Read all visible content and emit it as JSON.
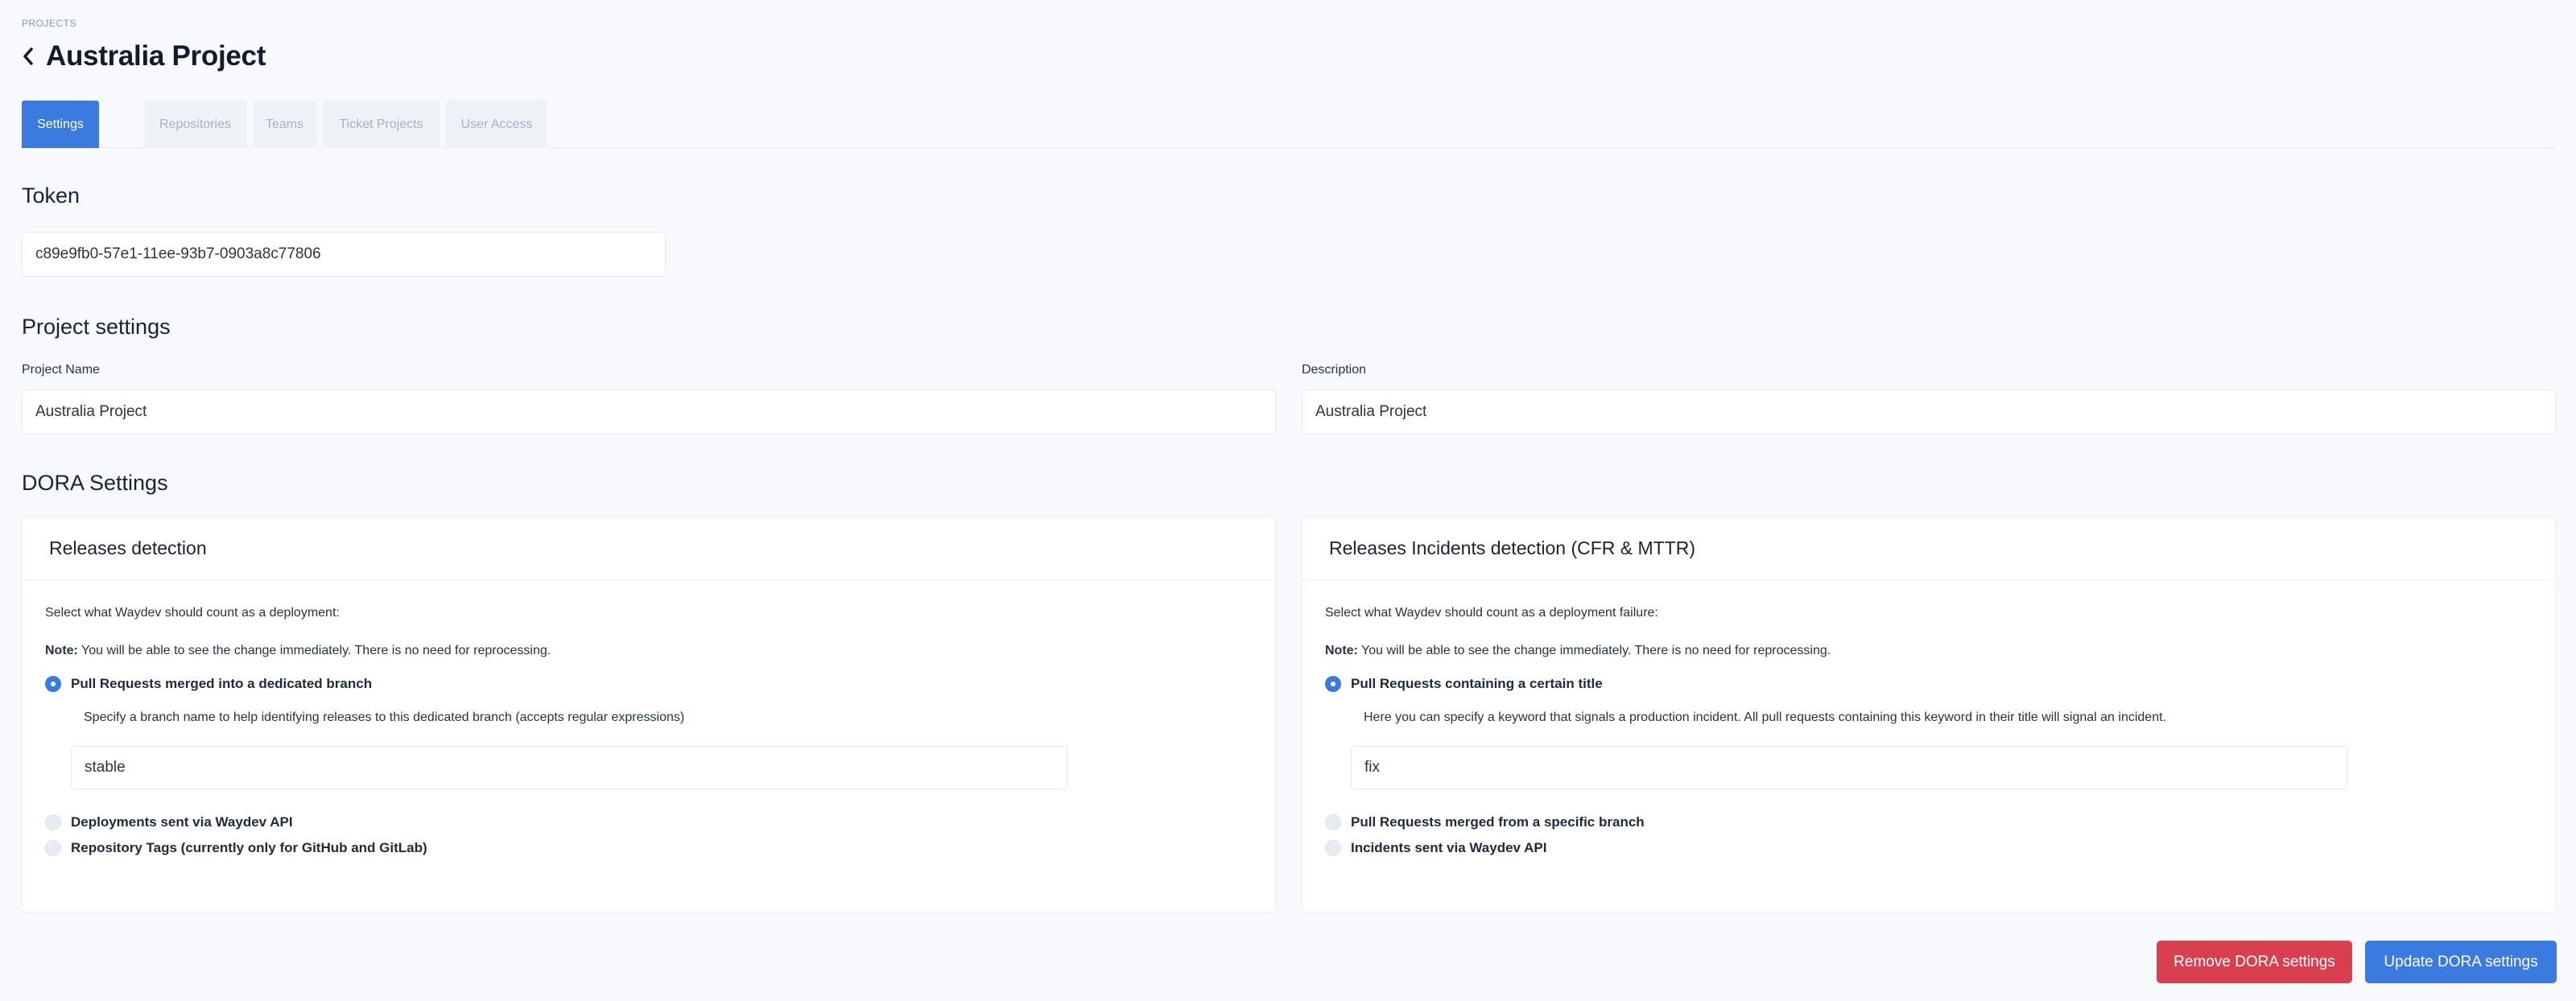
{
  "breadcrumb": "PROJECTS",
  "page_title": "Australia Project",
  "tabs": [
    {
      "label": "Settings",
      "active": true
    },
    {
      "label": "Repositories",
      "active": false
    },
    {
      "label": "Teams",
      "active": false
    },
    {
      "label": "Ticket Projects",
      "active": false
    },
    {
      "label": "User Access",
      "active": false
    }
  ],
  "token": {
    "heading": "Token",
    "value": "c89e9fb0-57e1-11ee-93b7-0903a8c77806"
  },
  "project_settings": {
    "heading": "Project settings",
    "name_label": "Project Name",
    "name_value": "Australia Project",
    "description_label": "Description",
    "description_value": "Australia Project"
  },
  "dora": {
    "heading": "DORA Settings",
    "releases": {
      "title": "Releases detection",
      "intro": "Select what Waydev should count as a deployment:",
      "note_label": "Note:",
      "note_text": " You will be able to see the change immediately. There is no need for reprocessing.",
      "options": [
        {
          "label": "Pull Requests merged into a dedicated branch",
          "checked": true
        },
        {
          "label": "Deployments sent via Waydev API",
          "checked": false
        },
        {
          "label": "Repository Tags (currently only for GitHub and GitLab)",
          "checked": false
        }
      ],
      "helper": "Specify a branch name to help identifying releases to this dedicated branch (accepts regular expressions)",
      "input_value": "stable"
    },
    "incidents": {
      "title": "Releases Incidents detection (CFR & MTTR)",
      "intro": "Select what Waydev should count as a deployment failure:",
      "note_label": "Note:",
      "note_text": " You will be able to see the change immediately. There is no need for reprocessing.",
      "options": [
        {
          "label": "Pull Requests containing a certain title",
          "checked": true
        },
        {
          "label": "Pull Requests merged from a specific branch",
          "checked": false
        },
        {
          "label": "Incidents sent via Waydev API",
          "checked": false
        }
      ],
      "helper": "Here you can specify a keyword that signals a production incident. All pull requests containing this keyword in their title will signal an incident.",
      "input_value": "fix"
    }
  },
  "buttons": {
    "remove": "Remove DORA settings",
    "update": "Update DORA settings"
  },
  "colors": {
    "accent": "#3b7be0",
    "danger": "#d9404f",
    "background": "#f7f9fc"
  }
}
